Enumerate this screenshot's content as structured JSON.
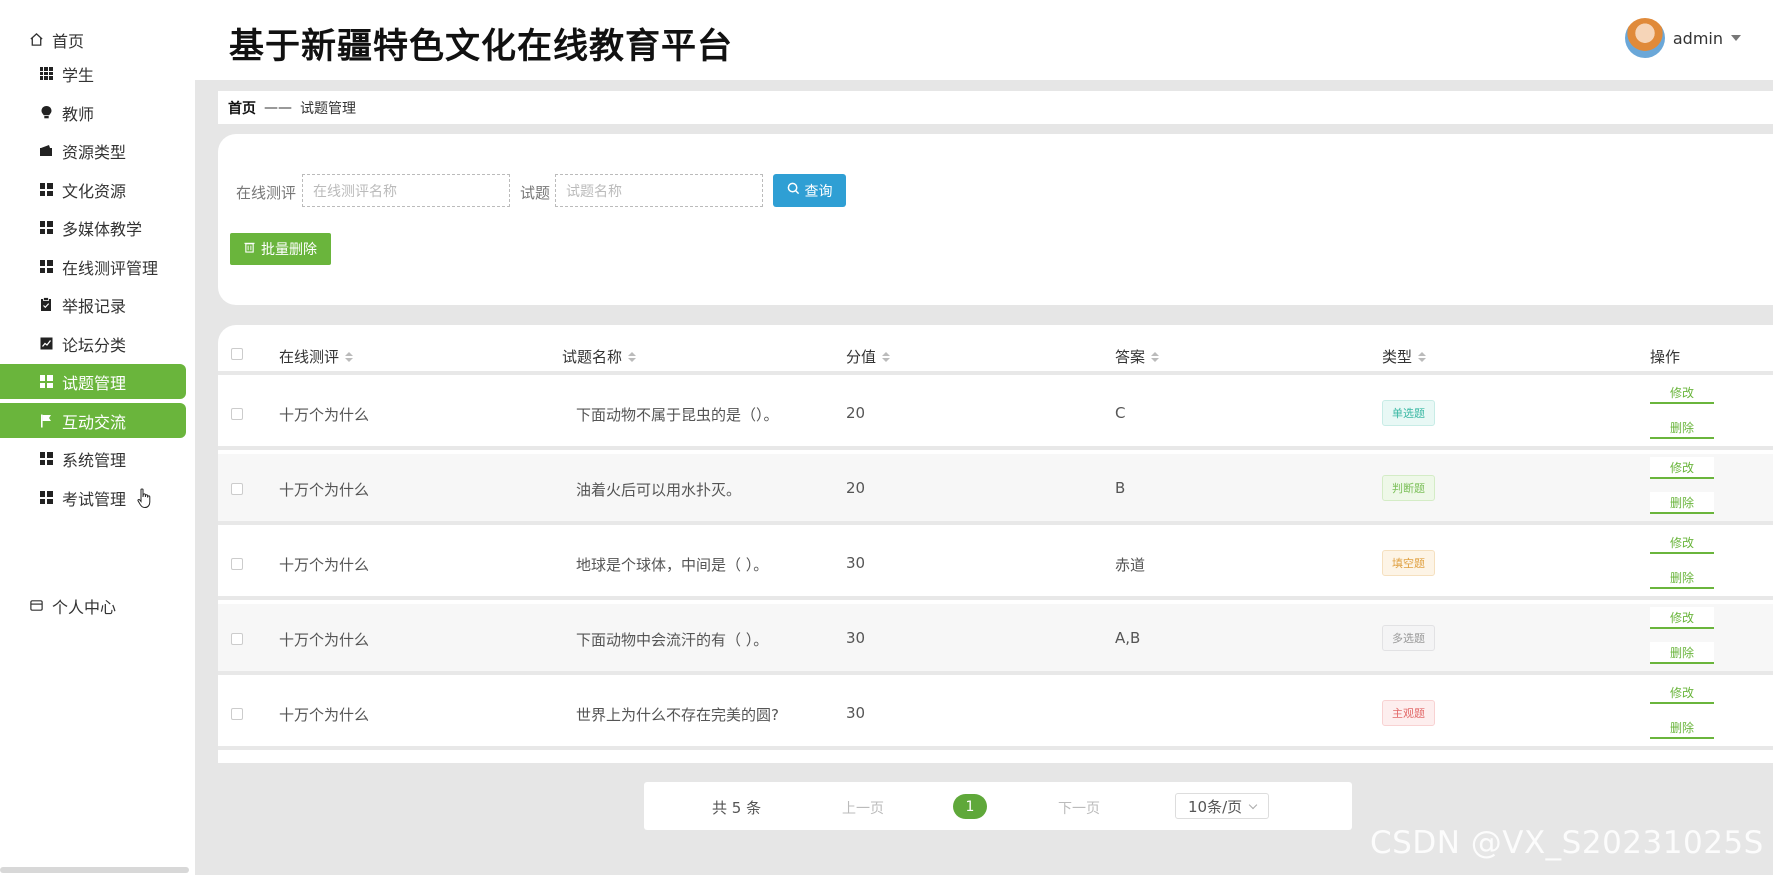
{
  "app": {
    "title": "基于新疆特色文化在线教育平台",
    "user_name": "admin"
  },
  "sidebar": {
    "home": "首页",
    "items": [
      {
        "label": "学生",
        "icon": "grid9-icon"
      },
      {
        "label": "教师",
        "icon": "bulb-icon"
      },
      {
        "label": "资源类型",
        "icon": "wallet-icon"
      },
      {
        "label": "文化资源",
        "icon": "grid-icon"
      },
      {
        "label": "多媒体教学",
        "icon": "grid-icon"
      },
      {
        "label": "在线测评管理",
        "icon": "grid-icon"
      },
      {
        "label": "举报记录",
        "icon": "clipboard-icon"
      },
      {
        "label": "论坛分类",
        "icon": "chart-icon"
      },
      {
        "label": "试题管理",
        "icon": "grid-icon",
        "active": true
      },
      {
        "label": "互动交流",
        "icon": "flag-icon",
        "active": true
      },
      {
        "label": "系统管理",
        "icon": "grid-icon"
      },
      {
        "label": "考试管理",
        "icon": "grid-icon"
      }
    ],
    "personal": "个人中心"
  },
  "breadcrumb": {
    "home": "首页",
    "separator": "——",
    "current": "试题管理"
  },
  "search": {
    "label_eval": "在线测评",
    "placeholder_eval": "在线测评名称",
    "label_question": "试题",
    "placeholder_question": "试题名称",
    "query_button": "查询",
    "batch_delete_button": "批量删除"
  },
  "table": {
    "headers": [
      "在线测评",
      "试题名称",
      "分值",
      "答案",
      "类型",
      "操作"
    ],
    "rows": [
      {
        "eval": "十万个为什么",
        "question": "下面动物不属于昆虫的是（）。",
        "score": "20",
        "answer": "C",
        "type": "单选题"
      },
      {
        "eval": "十万个为什么",
        "question": "油着火后可以用水扑灭。",
        "score": "20",
        "answer": "B",
        "type": "判断题"
      },
      {
        "eval": "十万个为什么",
        "question": "地球是个球体，中间是（ ）。",
        "score": "30",
        "answer": "赤道",
        "type": "填空题"
      },
      {
        "eval": "十万个为什么",
        "question": "下面动物中会流汗的有（ ）。",
        "score": "30",
        "answer": "A,B",
        "type": "多选题"
      },
      {
        "eval": "十万个为什么",
        "question": "世界上为什么不存在完美的圆?",
        "score": "30",
        "answer": "",
        "type": "主观题"
      }
    ],
    "edit_label": "修改",
    "delete_label": "删除"
  },
  "tag_colors": {
    "单选题": {
      "fg": "#3bb8a4",
      "bg": "#e8f8f5",
      "border": "#c8ece6"
    },
    "判断题": {
      "fg": "#7cc05a",
      "bg": "#eef8e8",
      "border": "#d4ecc6"
    },
    "填空题": {
      "fg": "#e0a142",
      "bg": "#fdf4e6",
      "border": "#f5e0bf"
    },
    "多选题": {
      "fg": "#999999",
      "bg": "#f4f4f5",
      "border": "#e2e2e4"
    },
    "主观题": {
      "fg": "#e26a6a",
      "bg": "#fdeeee",
      "border": "#f8d2d2"
    }
  },
  "pagination": {
    "total": "共 5 条",
    "prev": "上一页",
    "current": "1",
    "next": "下一页",
    "page_size": "10条/页"
  },
  "watermark": "CSDN @VX_S20231025S"
}
